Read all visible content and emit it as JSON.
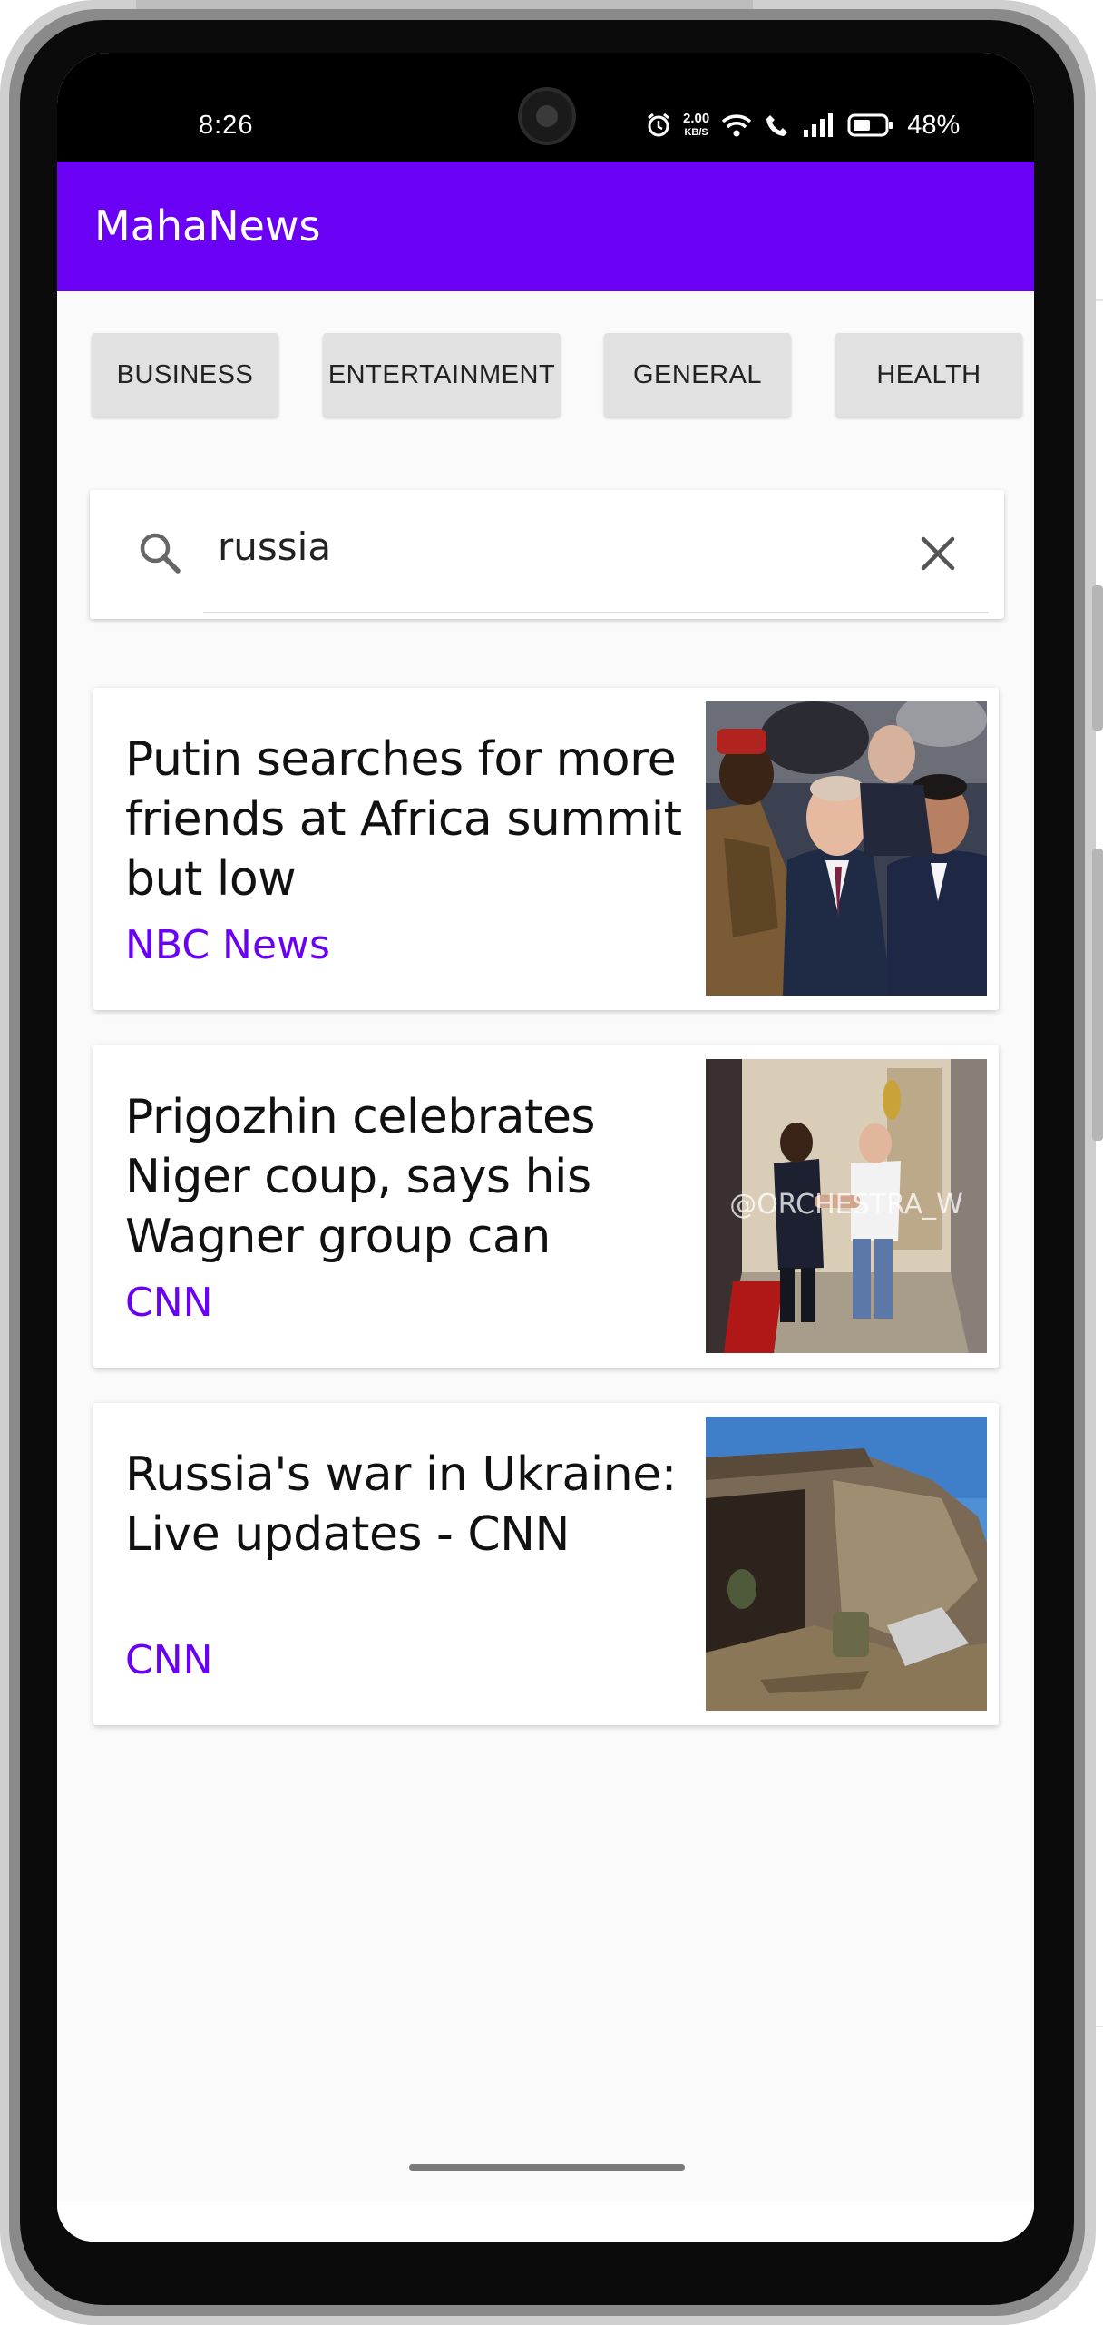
{
  "status_bar": {
    "time": "8:26",
    "net_speed_value": "2.00",
    "net_speed_unit": "KB/S",
    "battery": "48%"
  },
  "app_bar": {
    "title": "MahaNews",
    "color": "#6a00f4"
  },
  "categories": [
    "BUSINESS",
    "ENTERTAINMENT",
    "GENERAL",
    "HEALTH"
  ],
  "search": {
    "value": "russia"
  },
  "articles": [
    {
      "title": "Putin searches for more friends at Africa summit but low",
      "source": "NBC News",
      "image": "summit-photo"
    },
    {
      "title": "Prigozhin celebrates Niger coup, says his Wagner group can",
      "source": "CNN",
      "image": "handshake-photo",
      "watermark": "@ORCHESTRA_W"
    },
    {
      "title": "Russia's war in Ukraine: Live updates - CNN",
      "source": "CNN",
      "image": "ruins-photo"
    }
  ]
}
